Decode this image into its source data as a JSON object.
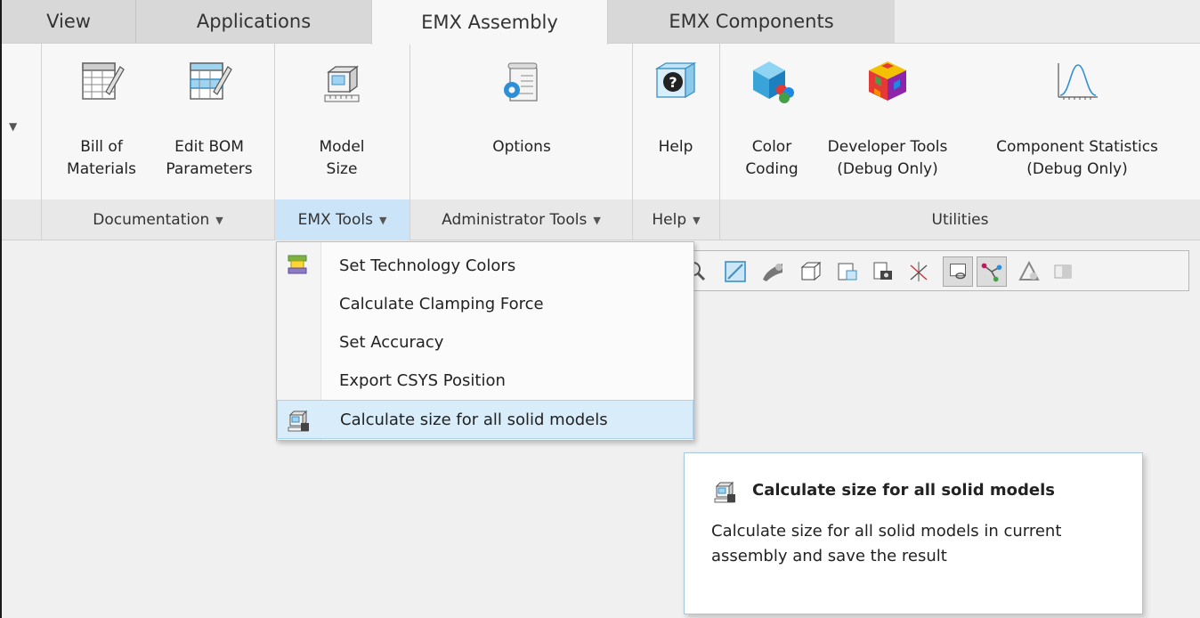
{
  "tabs": [
    {
      "label": "View"
    },
    {
      "label": "Applications"
    },
    {
      "label": "EMX Assembly",
      "active": true
    },
    {
      "label": "EMX Components"
    }
  ],
  "ribbon": {
    "collapse_icon": "triangle-down-icon",
    "buttons": {
      "bom": "Bill of\nMaterials",
      "edit_bom": "Edit BOM\nParameters",
      "model_size": "Model\nSize",
      "options": "Options",
      "help": "Help",
      "color_coding": "Color\nCoding",
      "developer_tools": "Developer Tools\n(Debug Only)",
      "component_statistics": "Component Statistics\n(Debug Only)"
    },
    "groups": {
      "documentation": "Documentation",
      "emx_tools": "EMX Tools",
      "administrator_tools": "Administrator Tools",
      "help": "Help",
      "utilities": "Utilities"
    }
  },
  "menu": {
    "items": [
      {
        "label": "Set Technology Colors",
        "icon": "technology-colors-icon"
      },
      {
        "label": "Calculate Clamping Force",
        "icon": ""
      },
      {
        "label": "Set Accuracy",
        "icon": ""
      },
      {
        "label": "Export CSYS Position",
        "icon": ""
      },
      {
        "label": "Calculate size for all solid models",
        "icon": "calculate-size-icon",
        "hover": true
      }
    ]
  },
  "tooltip": {
    "title": "Calculate size for all solid models",
    "body": "Calculate size for all solid models in current assembly and save the result"
  },
  "colors": {
    "active_group": "#cce4f7",
    "menu_hover": "#d8ecfa",
    "tooltip_border": "#a4c8e2"
  }
}
